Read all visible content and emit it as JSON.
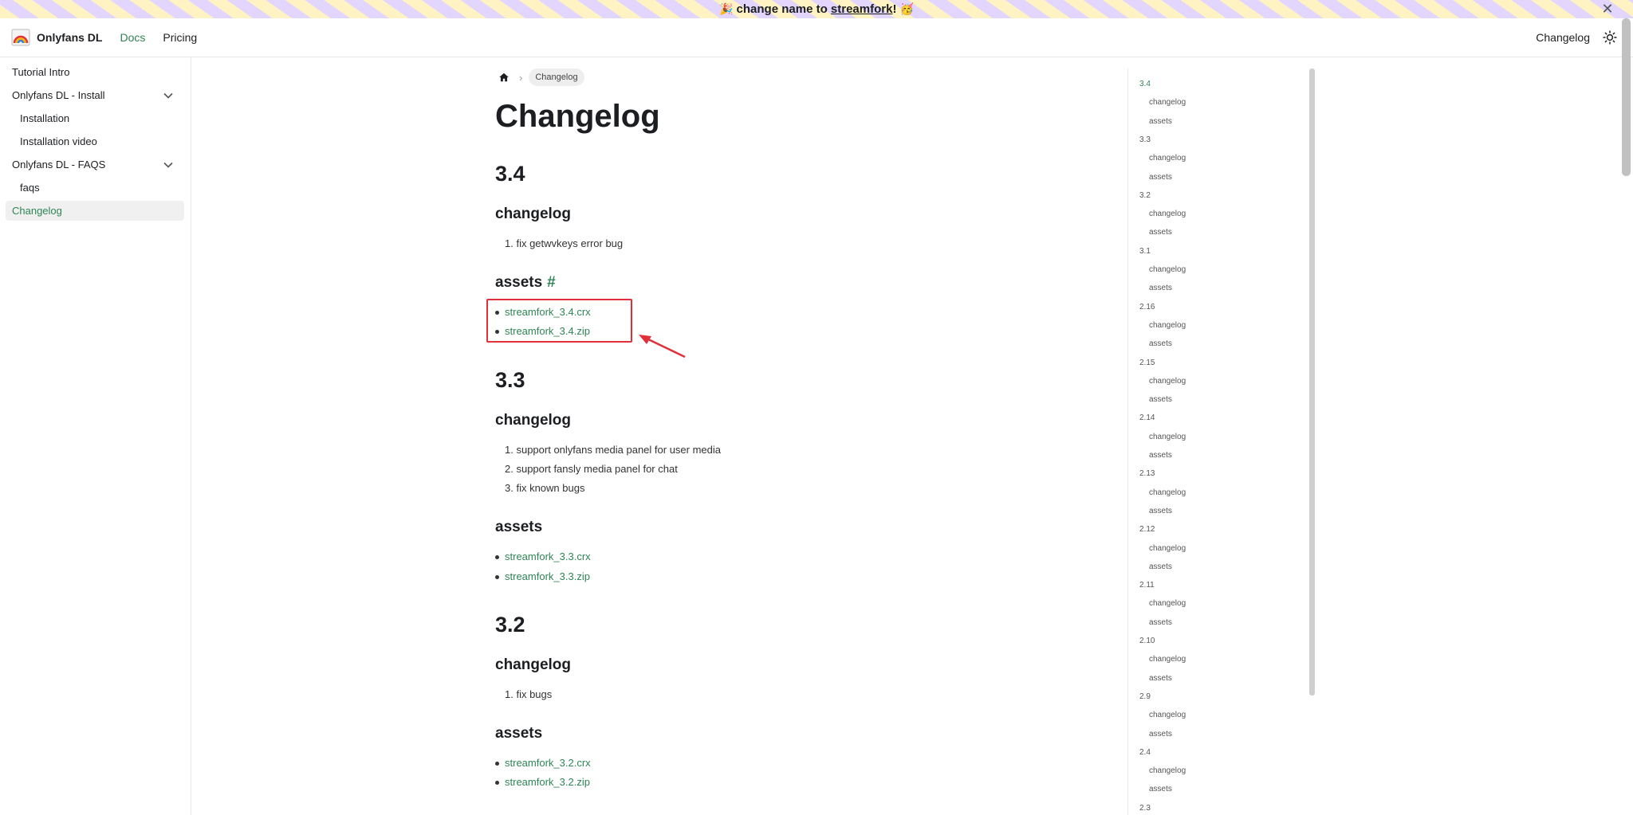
{
  "announcement": {
    "emoji_start": "🎉",
    "text_before": "change name to ",
    "link_text": "streamfork",
    "text_after": "!",
    "emoji_end": "🥳",
    "close_icon": "✕"
  },
  "navbar": {
    "brand": "Onlyfans DL",
    "links": [
      "Docs",
      "Pricing"
    ],
    "right_link": "Changelog",
    "theme_icon": "sun-icon",
    "accent_color": "#2e8555"
  },
  "sidebar": {
    "items": [
      {
        "label": "Tutorial Intro"
      },
      {
        "label": "Onlyfans DL - Install"
      },
      {
        "label": "Installation"
      },
      {
        "label": "Installation video"
      },
      {
        "label": "Onlyfans DL - FAQS"
      },
      {
        "label": "faqs"
      },
      {
        "label": "Changelog"
      }
    ]
  },
  "breadcrumb": {
    "current": "Changelog"
  },
  "main": {
    "title": "Changelog",
    "sections": [
      {
        "version": "3.4",
        "changelog_heading": "changelog",
        "changes": [
          "fix getwvkeys error bug"
        ],
        "assets_heading": "assets",
        "assets_anchor": "#",
        "assets": [
          "streamfork_3.4.crx",
          "streamfork_3.4.zip"
        ]
      },
      {
        "version": "3.3",
        "changelog_heading": "changelog",
        "changes": [
          "support onlyfans media panel for user media",
          "support fansly media panel for chat",
          "fix known bugs"
        ],
        "assets_heading": "assets",
        "assets": [
          "streamfork_3.3.crx",
          "streamfork_3.3.zip"
        ]
      },
      {
        "version": "3.2",
        "changelog_heading": "changelog",
        "changes": [
          "fix bugs"
        ],
        "assets_heading": "assets",
        "assets": [
          "streamfork_3.2.crx",
          "streamfork_3.2.zip"
        ]
      }
    ]
  },
  "toc": {
    "versions": [
      "3.4",
      "3.3",
      "3.2",
      "3.1",
      "2.16",
      "2.15",
      "2.14",
      "2.13",
      "2.12",
      "2.11",
      "2.10",
      "2.9",
      "2.4",
      "2.3"
    ],
    "sub_items": [
      "changelog",
      "assets"
    ]
  }
}
